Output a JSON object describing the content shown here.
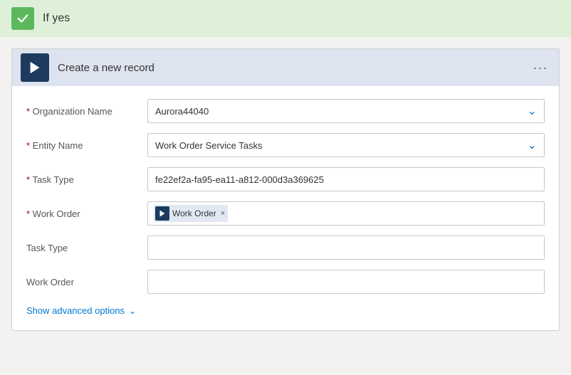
{
  "header": {
    "title": "If yes",
    "check_icon": "check-icon"
  },
  "action": {
    "title": "Create a new record",
    "more_icon": "more-icon",
    "icon": "flow-icon"
  },
  "form": {
    "fields": [
      {
        "label": "Organization Name",
        "required": true,
        "type": "dropdown",
        "value": "Aurora44040",
        "name": "organization-name-field"
      },
      {
        "label": "Entity Name",
        "required": true,
        "type": "dropdown",
        "value": "Work Order Service Tasks",
        "name": "entity-name-field"
      },
      {
        "label": "Task Type",
        "required": true,
        "type": "input",
        "value": "fe22ef2a-fa95-ea11-a812-000d3a369625",
        "name": "task-type-required-field"
      },
      {
        "label": "Work Order",
        "required": true,
        "type": "tag",
        "tag_label": "Work Order",
        "name": "work-order-required-field"
      },
      {
        "label": "Task Type",
        "required": false,
        "type": "input",
        "value": "",
        "name": "task-type-field"
      },
      {
        "label": "Work Order",
        "required": false,
        "type": "input",
        "value": "",
        "name": "work-order-field"
      }
    ],
    "advanced_options_label": "Show advanced options",
    "advanced_options_name": "show-advanced-options"
  }
}
